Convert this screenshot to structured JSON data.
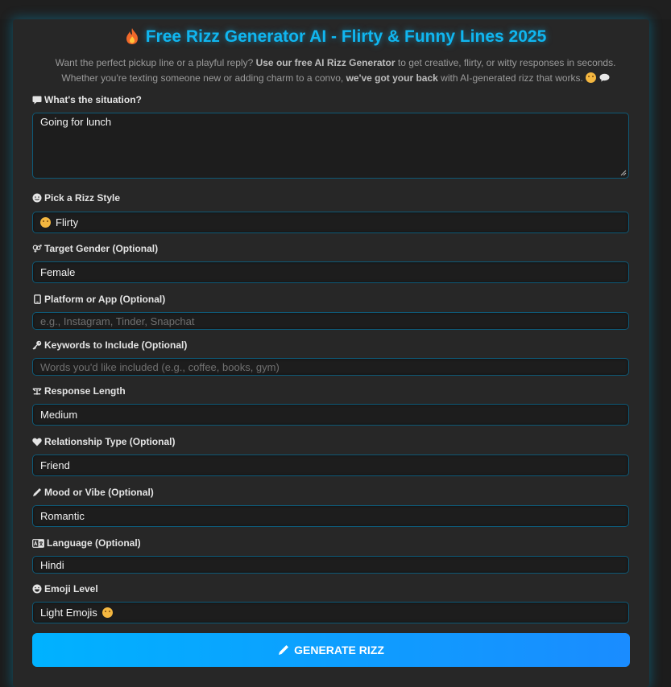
{
  "header": {
    "title": "Free Rizz Generator AI - Flirty & Funny Lines 2025",
    "intro_part1": "Want the perfect pickup line or a playful reply? ",
    "intro_bold1": "Use our free AI Rizz Generator",
    "intro_part2": " to get creative, flirty, or witty responses in seconds. Whether you're texting someone new or adding charm to a convo, ",
    "intro_bold2": "we've got your back",
    "intro_part3": " with AI-generated rizz that works."
  },
  "form": {
    "situation": {
      "label": "What's the situation?",
      "value": "Going for lunch"
    },
    "style": {
      "label": "Pick a Rizz Style",
      "value": "Flirty"
    },
    "gender": {
      "label": "Target Gender (Optional)",
      "value": "Female"
    },
    "platform": {
      "label": "Platform or App (Optional)",
      "placeholder": "e.g., Instagram, Tinder, Snapchat"
    },
    "keywords": {
      "label": "Keywords to Include (Optional)",
      "placeholder": "Words you'd like included (e.g., coffee, books, gym)"
    },
    "length": {
      "label": "Response Length",
      "value": "Medium"
    },
    "relationship": {
      "label": "Relationship Type (Optional)",
      "value": "Friend"
    },
    "mood": {
      "label": "Mood or Vibe (Optional)",
      "value": "Romantic"
    },
    "language": {
      "label": "Language (Optional)",
      "value": "Hindi"
    },
    "emoji_level": {
      "label": "Emoji Level",
      "value": "Light Emojis"
    }
  },
  "button": {
    "label": "GENERATE RIZZ"
  },
  "colors": {
    "accent": "#10b6f0",
    "field_border": "#0e5a78",
    "button_start": "#00b2ff",
    "button_end": "#1a8cff"
  }
}
